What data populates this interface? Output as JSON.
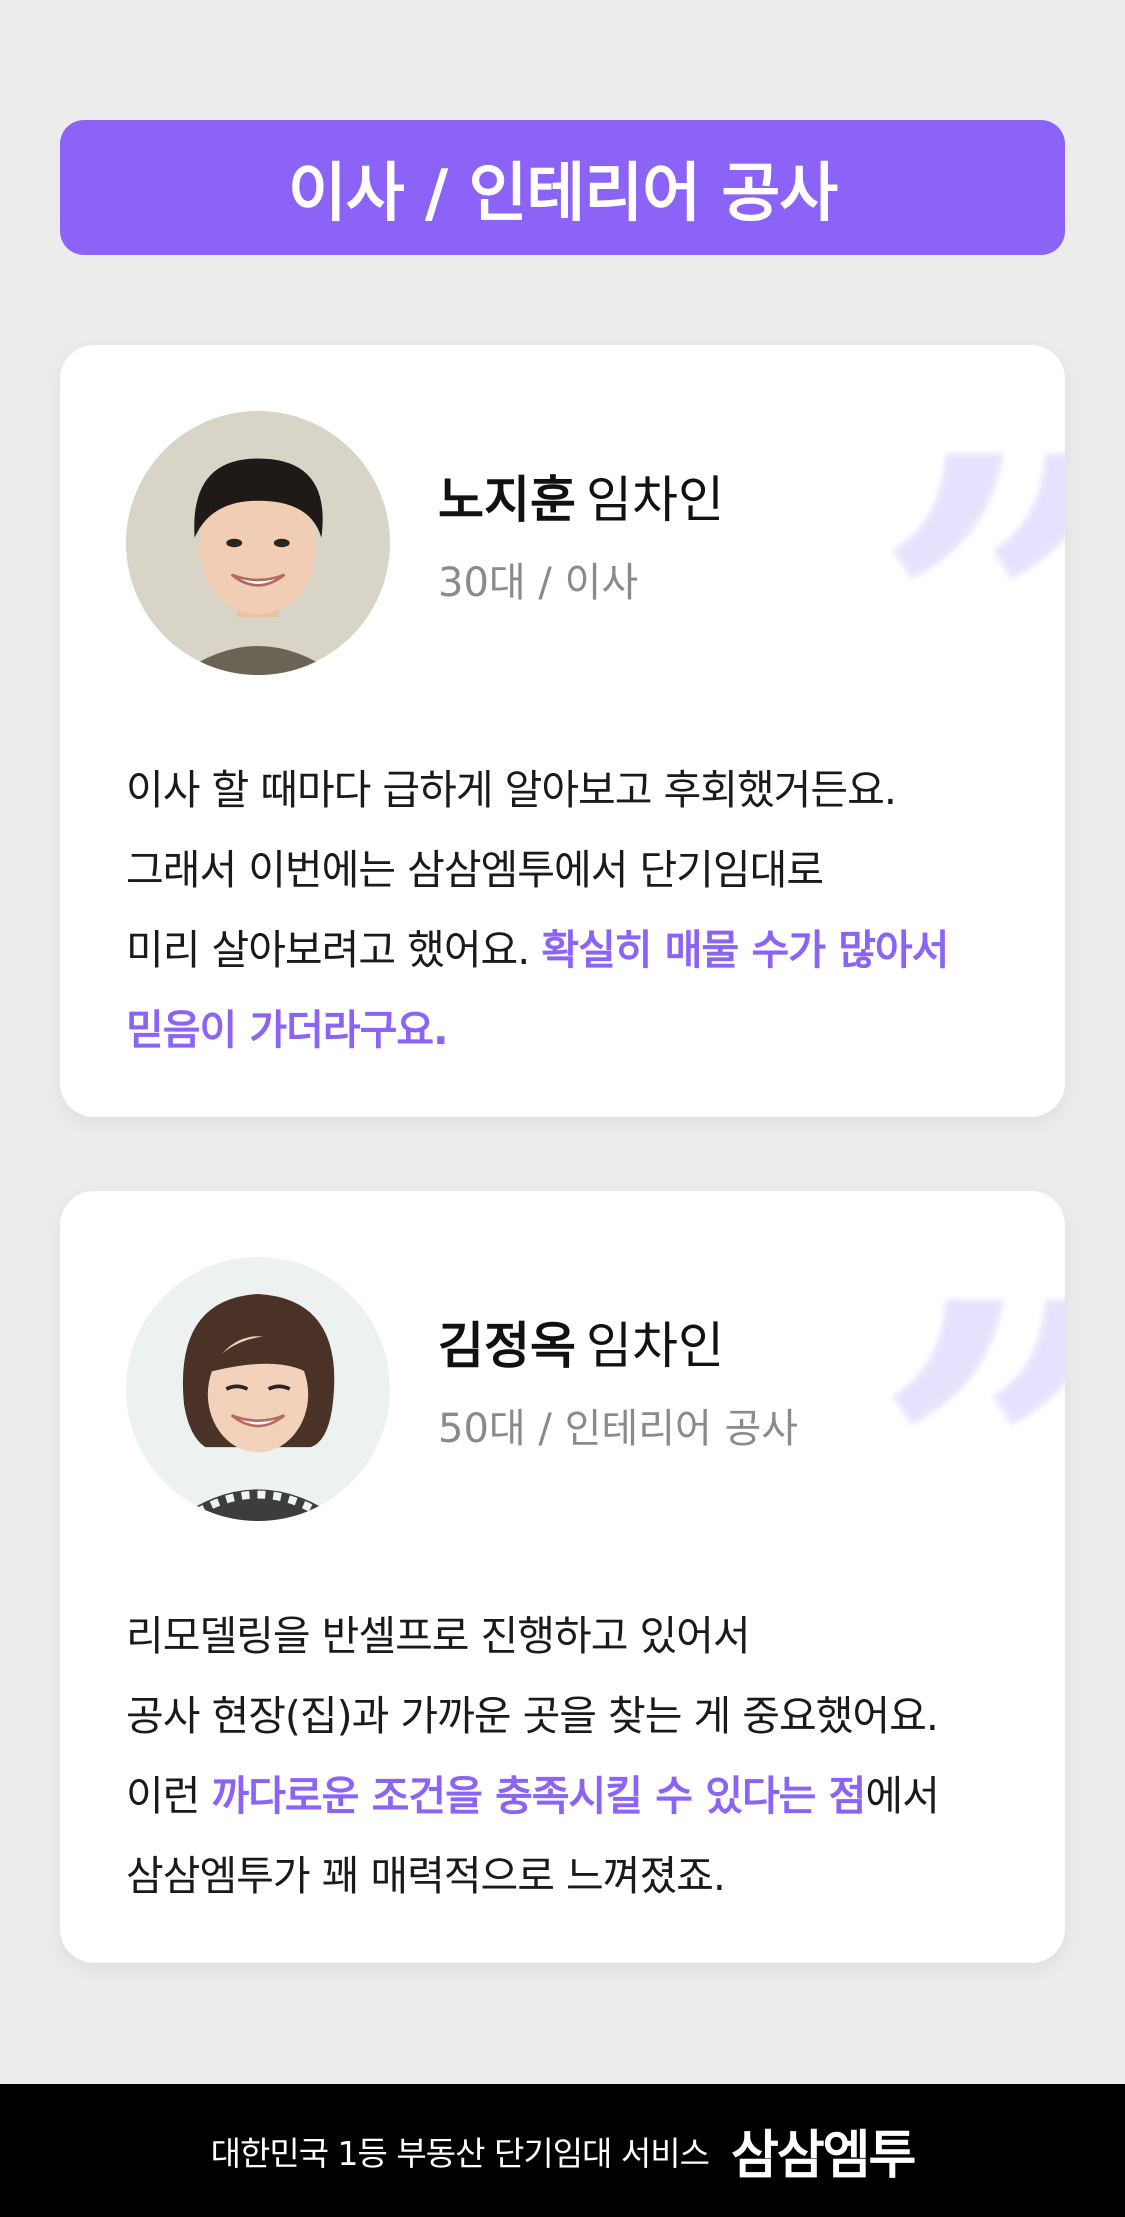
{
  "banner": {
    "title": "이사 / 인테리어 공사"
  },
  "cards": [
    {
      "name": "노지훈",
      "role": "임차인",
      "meta": "30대 / 이사",
      "line1": "이사 할 때마다 급하게 알아보고 후회했거든요.",
      "line2": "그래서 이번에는 삼삼엠투에서 단기임대로",
      "line3_pre": "미리 살아보려고 했어요. ",
      "line3_hl": "확실히 매물 수가 많아서",
      "line4_hl": "믿음이 가더라구요."
    },
    {
      "name": "김정옥",
      "role": "임차인",
      "meta": "50대 / 인테리어 공사",
      "line1": "리모델링을 반셀프로 진행하고 있어서",
      "line2": "공사 현장(집)과 가까운 곳을 찾는 게 중요했어요.",
      "line3_pre": "이런 ",
      "line3_hl": "까다로운 조건을 충족시킬 수 있다는 점",
      "line3_post": "에서",
      "line4": "삼삼엠투가 꽤 매력적으로 느껴졌죠."
    }
  ],
  "footer": {
    "tagline": "대한민국 1등 부동산 단기임대 서비스",
    "logo": "삼삼엠투"
  },
  "colors": {
    "accent": "#8b63f7",
    "background": "#ececec",
    "footer": "#000000"
  },
  "icons": [
    "quote-mark-icon"
  ]
}
